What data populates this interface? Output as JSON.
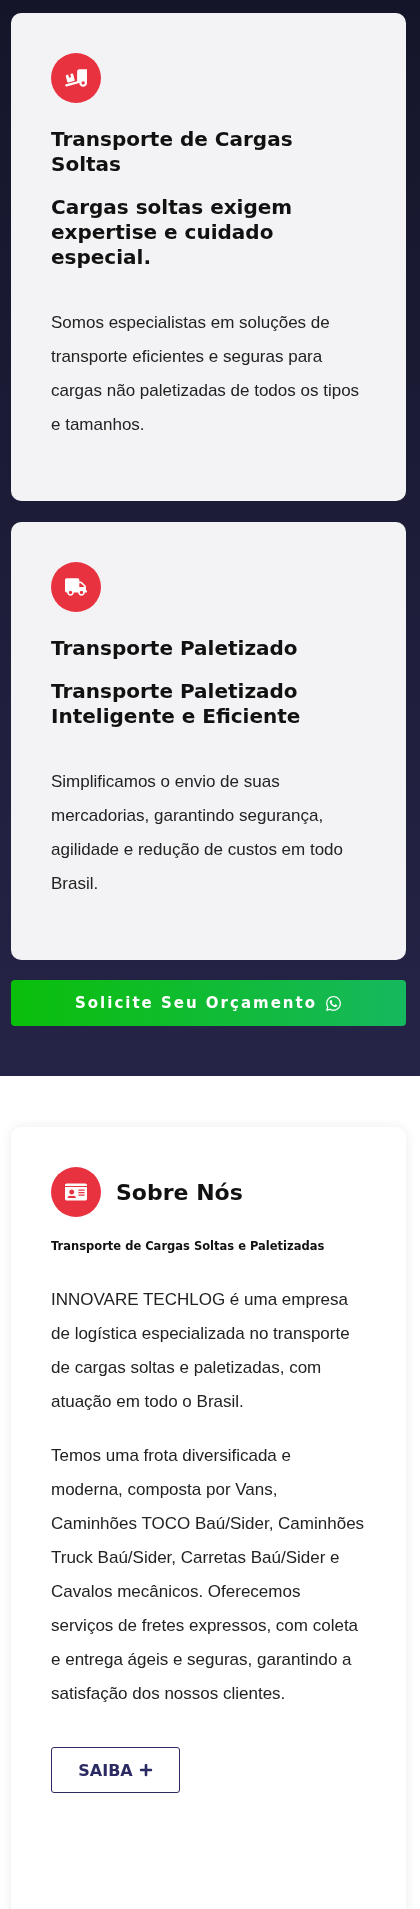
{
  "services": [
    {
      "title": "Transporte de Cargas Soltas",
      "subtitle": "Cargas soltas exigem expertise e cuidado especial.",
      "text": "Somos especialistas em soluções de transporte eficientes e seguras para cargas não paletizadas de todos os tipos e tamanhos."
    },
    {
      "title": "Transporte Paletizado",
      "subtitle": "Transporte Paletizado Inteligente e Eficiente",
      "text": "Simplificamos o envio de suas mercadorias, garantindo segurança, agilidade e redução de custos em todo Brasil."
    }
  ],
  "quote_button": {
    "label": "Solicite Seu Orçamento"
  },
  "about": {
    "title": "Sobre Nós",
    "subtitle": "Transporte de Cargas Soltas e Paletizadas",
    "paragraphs": [
      "INNOVARE TECHLOG é uma empresa de logística especializada no transporte de cargas soltas e paletizadas, com atuação em todo o Brasil.",
      "Temos uma frota diversificada e moderna, composta por Vans, Caminhões TOCO Baú/Sider, Caminhões Truck Baú/Sider, Carretas Baú/Sider e Cavalos mecânicos. Oferecemos serviços de fretes expressos, com coleta e entrega ágeis e seguras, garantindo a satisfação dos nossos clientes."
    ],
    "button": {
      "label": "SAIBA"
    }
  }
}
